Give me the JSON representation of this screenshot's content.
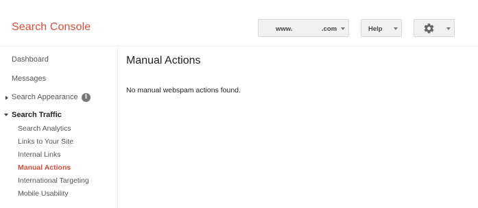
{
  "header": {
    "brand": "Search Console",
    "site_selector": {
      "prefix": "www.",
      "suffix": ".com"
    },
    "help_label": "Help",
    "settings_icon": "gear-icon"
  },
  "sidebar": {
    "items": [
      {
        "label": "Dashboard"
      },
      {
        "label": "Messages"
      },
      {
        "label": "Search Appearance",
        "icon": "info-icon",
        "expanded": false
      },
      {
        "label": "Search Traffic",
        "expanded": true,
        "children": [
          {
            "label": "Search Analytics"
          },
          {
            "label": "Links to Your Site"
          },
          {
            "label": "Internal Links"
          },
          {
            "label": "Manual Actions",
            "active": true
          },
          {
            "label": "International Targeting"
          },
          {
            "label": "Mobile Usability"
          }
        ]
      }
    ]
  },
  "main": {
    "title": "Manual Actions",
    "message": "No manual webspam actions found."
  },
  "colors": {
    "brand": "#dd4b39",
    "active_nav": "#dd4b39",
    "button_bg": "#f1f1f1"
  }
}
